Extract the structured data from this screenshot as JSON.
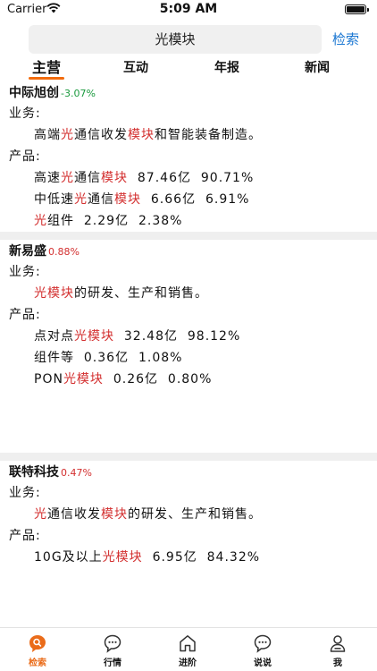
{
  "status_bar": {
    "carrier": "Carrier",
    "time": "5:09 AM"
  },
  "search": {
    "query": "光模块",
    "button": "检索"
  },
  "tabs": [
    "主营",
    "互动",
    "年报",
    "新闻"
  ],
  "active_tab": "主营",
  "labels": {
    "business": "业务:",
    "products": "产品:"
  },
  "colors": {
    "accent": "#f26b0d",
    "highlight": "#d32f2f",
    "down": "#1a9a3e",
    "link": "#1976d2"
  },
  "companies": [
    {
      "name": "中际旭创",
      "change": "-3.07%",
      "direction": "down",
      "business": [
        {
          "t": "高端",
          "h": false
        },
        {
          "t": "光",
          "h": true
        },
        {
          "t": "通信收发",
          "h": false
        },
        {
          "t": "模块",
          "h": true
        },
        {
          "t": "和智能装备制造。",
          "h": false
        }
      ],
      "products": [
        [
          {
            "t": "高速",
            "h": false
          },
          {
            "t": "光",
            "h": true
          },
          {
            "t": "通信",
            "h": false
          },
          {
            "t": "模块",
            "h": true
          },
          {
            "t": "  87.46亿  90.71%",
            "h": false
          }
        ],
        [
          {
            "t": "中低速",
            "h": false
          },
          {
            "t": "光",
            "h": true
          },
          {
            "t": "通信",
            "h": false
          },
          {
            "t": "模块",
            "h": true
          },
          {
            "t": "  6.66亿  6.91%",
            "h": false
          }
        ],
        [
          {
            "t": "光",
            "h": true
          },
          {
            "t": "组件  2.29亿  2.38%",
            "h": false
          }
        ]
      ]
    },
    {
      "name": "新易盛",
      "change": "0.88%",
      "direction": "up",
      "business": [
        {
          "t": "光模块",
          "h": true
        },
        {
          "t": "的研发、生产和销售。",
          "h": false
        }
      ],
      "products": [
        [
          {
            "t": "点对点",
            "h": false
          },
          {
            "t": "光模块",
            "h": true
          },
          {
            "t": "  32.48亿  98.12%",
            "h": false
          }
        ],
        [
          {
            "t": "组件等  0.36亿  1.08%",
            "h": false
          }
        ],
        [
          {
            "t": "PON",
            "h": false
          },
          {
            "t": "光模块",
            "h": true
          },
          {
            "t": "  0.26亿  0.80%",
            "h": false
          }
        ]
      ]
    },
    {
      "name": "联特科技",
      "change": "0.47%",
      "direction": "up",
      "business": [
        {
          "t": "光",
          "h": true
        },
        {
          "t": "通信收发",
          "h": false
        },
        {
          "t": "模块",
          "h": true
        },
        {
          "t": "的研发、生产和销售。",
          "h": false
        }
      ],
      "products": [
        [
          {
            "t": "10G及以上",
            "h": false
          },
          {
            "t": "光模块",
            "h": true
          },
          {
            "t": "  6.95亿  84.32%",
            "h": false
          }
        ]
      ]
    }
  ],
  "bottom_tabs": [
    {
      "label": "检索",
      "icon": "search-chat-icon",
      "active": true
    },
    {
      "label": "行情",
      "icon": "chat-bubble-icon",
      "active": false
    },
    {
      "label": "进阶",
      "icon": "home-icon",
      "active": false
    },
    {
      "label": "说说",
      "icon": "chat-bubble-icon",
      "active": false
    },
    {
      "label": "我",
      "icon": "user-icon",
      "active": false
    }
  ]
}
